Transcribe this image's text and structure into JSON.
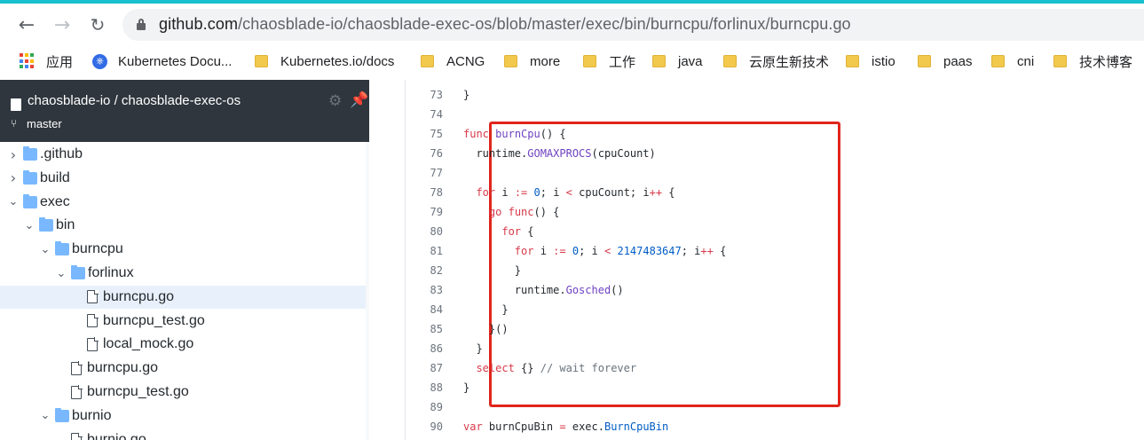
{
  "browser": {
    "url_host": "github.com",
    "url_path": "/chaosblade-io/chaosblade-exec-os/blob/master/exec/bin/burncpu/forlinux/burncpu.go",
    "bookmarks": [
      {
        "label": "应用",
        "icon": "apps-grid-icon"
      },
      {
        "label": "Kubernetes Docu...",
        "icon": "kubernetes-icon"
      },
      {
        "label": "Kubernetes.io/docs",
        "icon": "folder-icon"
      },
      {
        "label": "ACNG",
        "icon": "folder-icon"
      },
      {
        "label": "more",
        "icon": "folder-icon"
      },
      {
        "label": "工作",
        "icon": "folder-icon"
      },
      {
        "label": "java",
        "icon": "folder-icon"
      },
      {
        "label": "云原生新技术",
        "icon": "folder-icon"
      },
      {
        "label": "istio",
        "icon": "folder-icon"
      },
      {
        "label": "paas",
        "icon": "folder-icon"
      },
      {
        "label": "cni",
        "icon": "folder-icon"
      },
      {
        "label": "技术博客",
        "icon": "folder-icon"
      }
    ]
  },
  "sidebar": {
    "repo": "chaosblade-io / chaosblade-exec-os",
    "branch": "master",
    "tree": [
      {
        "label": ".github",
        "type": "folder",
        "expanded": false
      },
      {
        "label": "build",
        "type": "folder",
        "expanded": false
      },
      {
        "label": "exec",
        "type": "folder",
        "expanded": true
      },
      {
        "label": "bin",
        "type": "folder",
        "expanded": true
      },
      {
        "label": "burncpu",
        "type": "folder",
        "expanded": true
      },
      {
        "label": "forlinux",
        "type": "folder",
        "expanded": true
      },
      {
        "label": "burncpu.go",
        "type": "file",
        "selected": true
      },
      {
        "label": "burncpu_test.go",
        "type": "file"
      },
      {
        "label": "local_mock.go",
        "type": "file"
      },
      {
        "label": "burncpu.go",
        "type": "file"
      },
      {
        "label": "burncpu_test.go",
        "type": "file"
      },
      {
        "label": "burnio",
        "type": "folder",
        "expanded": true
      },
      {
        "label": "burnio.go",
        "type": "file"
      }
    ]
  },
  "code": {
    "lines": [
      {
        "n": "73",
        "t": "}"
      },
      {
        "n": "74",
        "t": ""
      },
      {
        "n": "75",
        "t": "func burnCpu() {"
      },
      {
        "n": "76",
        "t": "  runtime.GOMAXPROCS(cpuCount)"
      },
      {
        "n": "77",
        "t": ""
      },
      {
        "n": "78",
        "t": "  for i := 0; i < cpuCount; i++ {"
      },
      {
        "n": "79",
        "t": "    go func() {"
      },
      {
        "n": "80",
        "t": "      for {"
      },
      {
        "n": "81",
        "t": "        for i := 0; i < 2147483647; i++ {"
      },
      {
        "n": "82",
        "t": "        }"
      },
      {
        "n": "83",
        "t": "        runtime.Gosched()"
      },
      {
        "n": "84",
        "t": "      }"
      },
      {
        "n": "85",
        "t": "    }()"
      },
      {
        "n": "86",
        "t": "  }"
      },
      {
        "n": "87",
        "t": "  select {} // wait forever"
      },
      {
        "n": "88",
        "t": "}"
      },
      {
        "n": "89",
        "t": ""
      },
      {
        "n": "90",
        "t": "var burnCpuBin = exec.BurnCpuBin"
      }
    ]
  },
  "colors": {
    "keyword": "#d73a49",
    "function": "#6f42c1",
    "number": "#005cc5",
    "comment": "#6a737d",
    "highlight": "#e0251b"
  }
}
